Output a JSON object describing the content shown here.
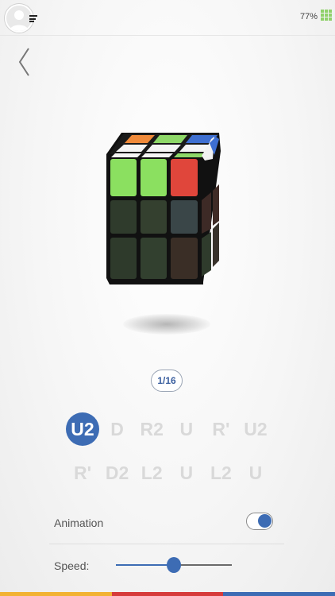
{
  "status": {
    "battery": "77%"
  },
  "step": {
    "counter": "1/16"
  },
  "moves": {
    "row1": [
      "U2",
      "D",
      "R2",
      "U",
      "R'",
      "U2"
    ],
    "row2": [
      "R'",
      "D2",
      "L2",
      "U",
      "L2",
      "U"
    ],
    "active_index": 0
  },
  "settings": {
    "animation_label": "Animation",
    "animation_on": true,
    "speed_label": "Speed:",
    "speed_fraction": 0.5
  },
  "colors": {
    "accent": "#3d6cb4",
    "battery": "#8fd16a",
    "bottom_bar": [
      "#f2b233",
      "#d63b3b",
      "#3d6cb4"
    ]
  },
  "icons": {
    "avatar": "user-silhouette-icon",
    "menu": "menu-lines-icon",
    "battery": "battery-grid-icon",
    "back": "chevron-left-icon"
  }
}
